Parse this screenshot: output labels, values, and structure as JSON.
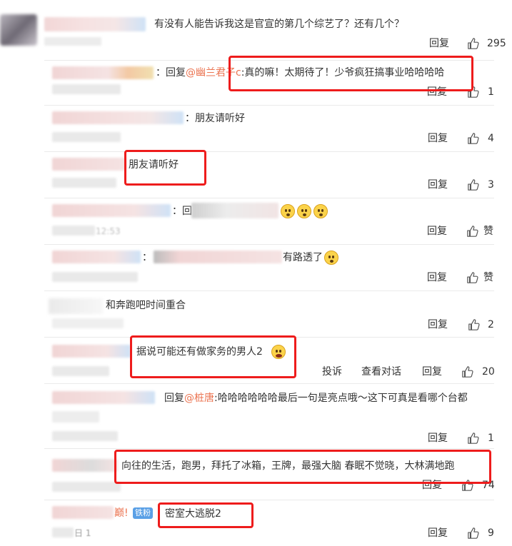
{
  "main_comment": {
    "text": "有没有人能告诉我这是官宣的第几个综艺了？还有几个？",
    "reply_label": "回复",
    "like_count": "295"
  },
  "replies": [
    {
      "prefix": "：回复",
      "mention": "@幽兰君子c",
      "text": ":真的嘛！太期待了！少爷疯狂搞事业哈哈哈哈",
      "reply_label": "回复",
      "like_count": "1"
    },
    {
      "prefix": "：",
      "mention": "",
      "text": "朋友请听好",
      "reply_label": "回复",
      "like_count": "4"
    },
    {
      "prefix": "",
      "mention": "",
      "text": "朋友请听好",
      "reply_label": "回复",
      "like_count": "3"
    },
    {
      "prefix": "：回",
      "mention": "",
      "text": "",
      "reply_label": "回复",
      "like_count": "赞"
    },
    {
      "prefix": "：",
      "mention": "",
      "text": "有路透了",
      "reply_label": "回复",
      "like_count": "赞"
    },
    {
      "prefix": "",
      "mention": "",
      "text": "和奔跑吧时间重合",
      "reply_label": "回复",
      "like_count": "2"
    },
    {
      "prefix": "",
      "mention": "",
      "text": "据说可能还有做家务的男人2",
      "report_label": "投诉",
      "view_conversation_label": "查看对话",
      "reply_label": "回复",
      "like_count": "20"
    },
    {
      "prefix": "回复",
      "mention": "@桩唐",
      "text": ":哈哈哈哈哈哈最后一句是亮点哦～这下可真是看哪个台都",
      "reply_label": "回复",
      "like_count": "1"
    },
    {
      "prefix": "",
      "mention": "",
      "text": "向往的生活，跑男，拜托了冰箱，王牌，最强大脑 春眠不觉晓，大林满地跑",
      "reply_label": "回复",
      "like_count": "74"
    },
    {
      "prefix": "巅!",
      "badge": "铁粉",
      "mention": "",
      "text": "密室大逃脱2",
      "reply_label": "回复",
      "like_count": "9"
    }
  ],
  "partial_texts": {
    "timestamp_fragment_4": "12:53",
    "timestamp_fragment_10": "日 1"
  },
  "colors": {
    "highlight_box": "#ee1c1c",
    "mention": "#eb7350",
    "badge": "#5aa0e6"
  }
}
